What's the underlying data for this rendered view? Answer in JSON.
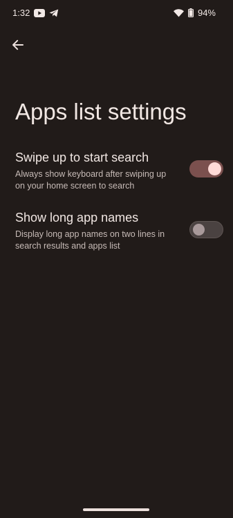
{
  "status_bar": {
    "time": "1:32",
    "battery": "94%",
    "icons": [
      "youtube-icon",
      "telegram-icon",
      "wifi-icon",
      "battery-icon"
    ]
  },
  "page": {
    "title": "Apps list settings"
  },
  "settings": [
    {
      "title": "Swipe up to start search",
      "description": "Always show keyboard after swiping up on your home screen to search",
      "enabled": true
    },
    {
      "title": "Show long app names",
      "description": "Display long app names on two lines in search results and apps list",
      "enabled": false
    }
  ],
  "colors": {
    "background": "#211b19",
    "switch_on_track": "#7b504e",
    "switch_on_thumb": "#ffdad7",
    "switch_off_track": "#4a4241",
    "switch_off_thumb": "#a8999a"
  }
}
